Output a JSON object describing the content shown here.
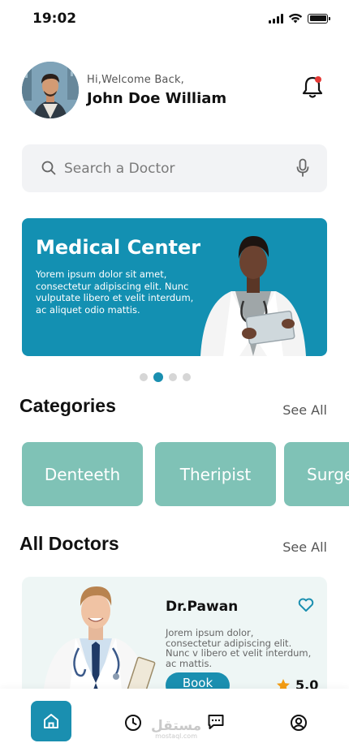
{
  "status_bar": {
    "time": "19:02"
  },
  "header": {
    "greeting": "Hi,Welcome Back,",
    "user_name": "John Doe William"
  },
  "search": {
    "placeholder": "Search a Doctor"
  },
  "banner": {
    "title": "Medical Center",
    "text": "Yorem ipsum dolor sit amet, consectetur adipiscing elit. Nunc vulputate libero et velit interdum, ac aliquet odio mattis.",
    "active_slide": 2,
    "slide_count": 4
  },
  "categories": {
    "title": "Categories",
    "see_all": "See All",
    "items": [
      "Denteeth",
      "Theripist",
      "Surgeon"
    ]
  },
  "doctors": {
    "title": "All Doctors",
    "see_all": "See All",
    "items": [
      {
        "name": "Dr.Pawan",
        "description": "Jorem ipsum dolor, consectetur adipiscing elit. Nunc v libero et velit interdum, ac  mattis.",
        "book_label": "Book",
        "rating": "5.0"
      }
    ]
  },
  "watermark": {
    "arabic": "مستقل",
    "latin": "mostaql.com"
  },
  "colors": {
    "primary": "#1a8fb0",
    "banner": "#1390b2",
    "category": "#7fc2b6",
    "card": "#eef6f5",
    "notification": "#e53935",
    "star": "#f39c12"
  }
}
